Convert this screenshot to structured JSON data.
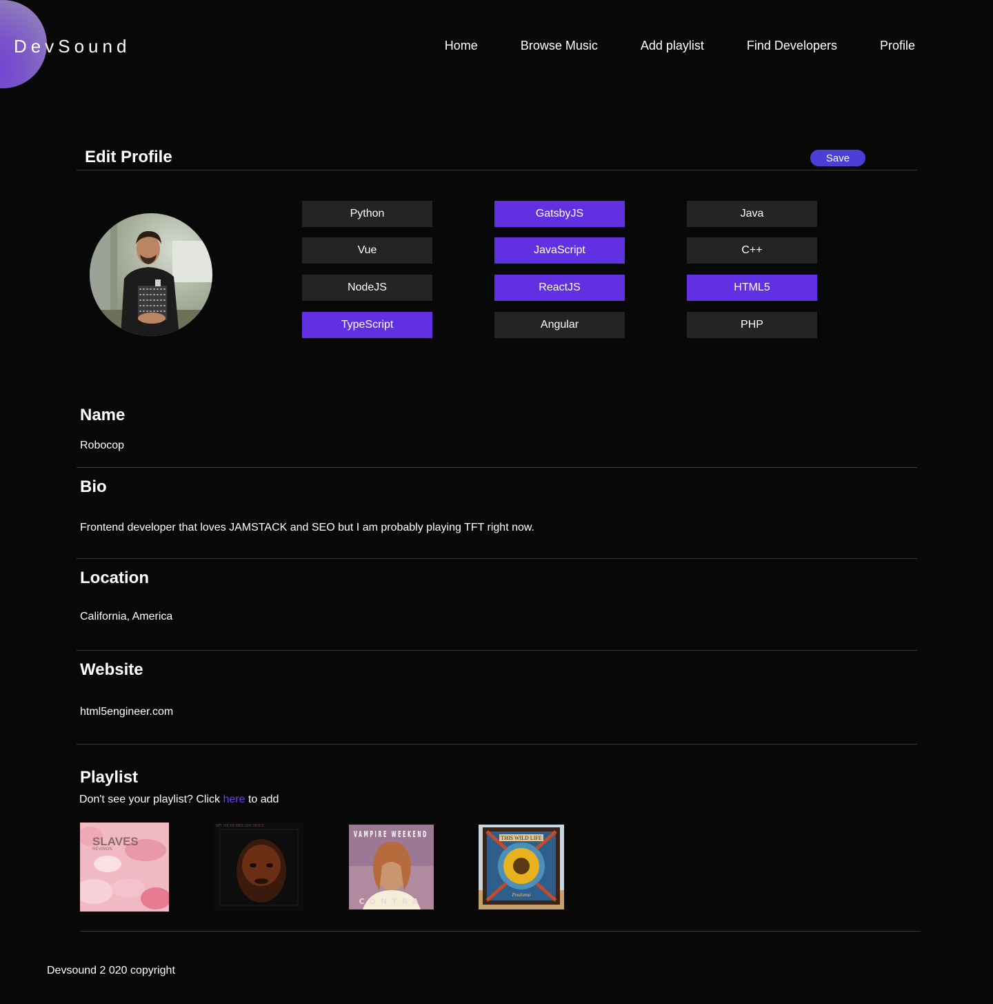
{
  "brand": {
    "name": "DevSound"
  },
  "nav": {
    "items": [
      {
        "label": "Home"
      },
      {
        "label": "Browse Music"
      },
      {
        "label": "Add playlist"
      },
      {
        "label": "Find Developers"
      },
      {
        "label": "Profile"
      }
    ]
  },
  "edit_profile": {
    "title": "Edit Profile",
    "save_label": "Save"
  },
  "tags": [
    {
      "label": "Python",
      "selected": false
    },
    {
      "label": "GatsbyJS",
      "selected": true
    },
    {
      "label": "Java",
      "selected": false
    },
    {
      "label": "Vue",
      "selected": false
    },
    {
      "label": "JavaScript",
      "selected": true
    },
    {
      "label": "C++",
      "selected": false
    },
    {
      "label": "NodeJS",
      "selected": false
    },
    {
      "label": "ReactJS",
      "selected": true
    },
    {
      "label": "HTML5",
      "selected": true
    },
    {
      "label": "TypeScript",
      "selected": true
    },
    {
      "label": "Angular",
      "selected": false
    },
    {
      "label": "PHP",
      "selected": false
    }
  ],
  "fields": {
    "name": {
      "label": "Name",
      "value": "Robocop"
    },
    "bio": {
      "label": "Bio",
      "value": "Frontend developer that loves JAMSTACK and SEO but I am probably playing TFT right now."
    },
    "location": {
      "label": "Location",
      "value": "California, America"
    },
    "website": {
      "label": "Website",
      "value": "html5engineer.com"
    }
  },
  "playlist": {
    "title": "Playlist",
    "hint_before": "Don't see your playlist? Click ",
    "hint_link": "here",
    "hint_after": " to add",
    "albums": [
      {
        "cover_text": "SLAVES",
        "cover_subtext": "REVISION"
      },
      {
        "cover_text": "MY DEAR MELANCHOLY,"
      },
      {
        "cover_text": "VAMPIRE WEEKEND",
        "cover_subtext": "CONTRA"
      },
      {
        "cover_text": "THIS WILD LIFE",
        "cover_subtext": "Petaluma"
      }
    ]
  },
  "footer": {
    "text": "Devsound 2 020 copyright"
  },
  "colors": {
    "background": "#080808",
    "accent": "#6230e3",
    "save_button": "#4b3fd6",
    "tag_inactive": "#242424",
    "link": "#6b3ff0"
  }
}
